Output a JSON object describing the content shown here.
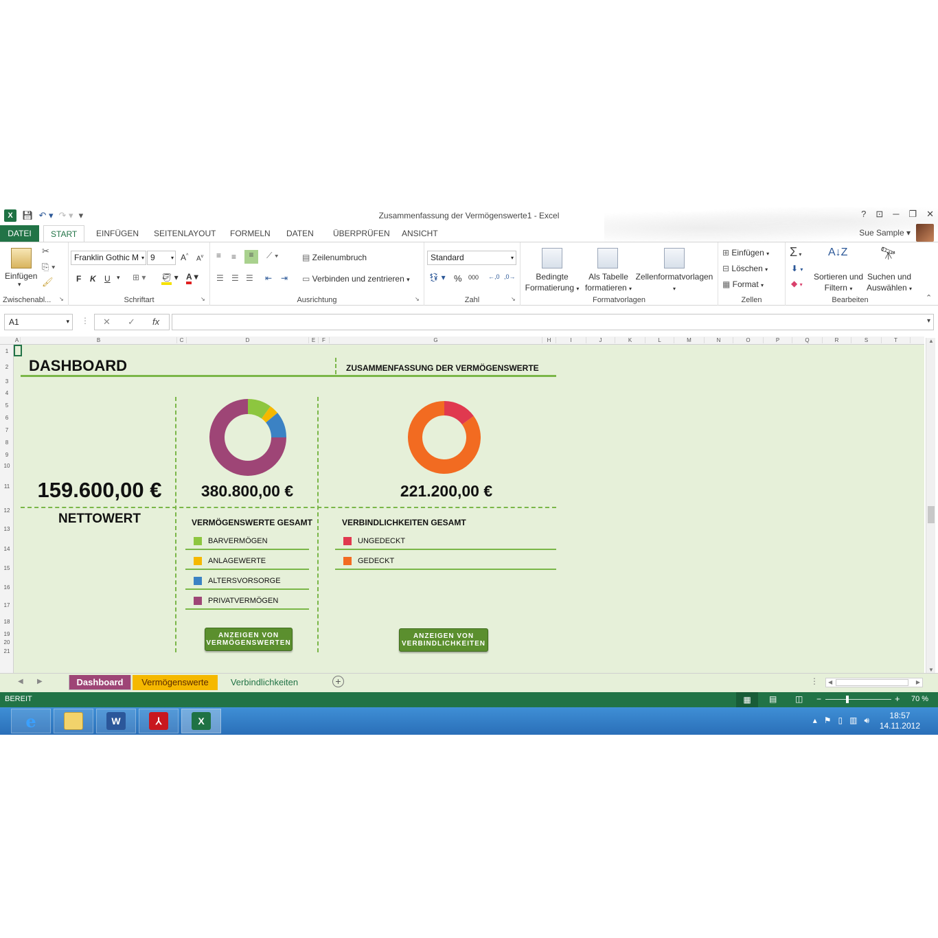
{
  "window": {
    "title": "Zusammenfassung der Vermögenswerte1 - Excel",
    "user": "Sue Sample",
    "help": "?",
    "controls": [
      "⊡",
      "─",
      "❐",
      "✕"
    ]
  },
  "ribbon_tabs": [
    "DATEI",
    "START",
    "EINFÜGEN",
    "SEITENLAYOUT",
    "FORMELN",
    "DATEN",
    "ÜBERPRÜFEN",
    "ANSICHT"
  ],
  "clipboard": {
    "paste_label": "Einfügen",
    "group_label": "Zwischenabl..."
  },
  "font": {
    "font_name": "Franklin Gothic M",
    "font_size": "9",
    "bold": "F",
    "italic": "K",
    "underline": "U",
    "group_label": "Schriftart"
  },
  "alignment": {
    "wrap_label": "Zeilenumbruch",
    "merge_label": "Verbinden und zentrieren",
    "group_label": "Ausrichtung"
  },
  "number": {
    "format": "Standard",
    "percent": "%",
    "thousands": "000",
    "group_label": "Zahl"
  },
  "styles": {
    "conditional": [
      "Bedingte",
      "Formatierung"
    ],
    "as_table": [
      "Als Tabelle",
      "formatieren"
    ],
    "cell_styles": "Zellenformatvorlagen",
    "group_label": "Formatvorlagen"
  },
  "cells": {
    "insert": "Einfügen",
    "delete": "Löschen",
    "format": "Format",
    "group_label": "Zellen"
  },
  "editing": {
    "sort": [
      "Sortieren und",
      "Filtern"
    ],
    "find": [
      "Suchen und",
      "Auswählen"
    ],
    "group_label": "Bearbeiten"
  },
  "formula_bar": {
    "name_box": "A1",
    "fx": "fx",
    "cancel": "✕",
    "confirm": "✓"
  },
  "columns": [
    "A",
    "B",
    "C",
    "D",
    "E",
    "F",
    "G",
    "H",
    "I",
    "J",
    "K",
    "L",
    "M",
    "N",
    "O",
    "P",
    "Q",
    "R",
    "S",
    "T"
  ],
  "rows": [
    "1",
    "2",
    "3",
    "4",
    "5",
    "6",
    "7",
    "8",
    "9",
    "10",
    "11",
    "12",
    "13",
    "14",
    "15",
    "16",
    "17",
    "18",
    "19",
    "20",
    "21"
  ],
  "dashboard": {
    "title": "DASHBOARD",
    "subtitle": "ZUSAMMENFASSUNG DER VERMÖGENSWERTE",
    "net_worth_value": "159.600,00 €",
    "net_worth_label": "NETTOWERT",
    "assets_total": "380.800,00 €",
    "assets_heading": "VERMÖGENSWERTE GESAMT",
    "assets_legend": [
      {
        "label": "BARVERMÖGEN",
        "color": "#8dc63f"
      },
      {
        "label": "ANLAGEWERTE",
        "color": "#f5b800"
      },
      {
        "label": "ALTERSVORSORGE",
        "color": "#3b82c4"
      },
      {
        "label": "PRIVATVERMÖGEN",
        "color": "#9e4576"
      }
    ],
    "assets_share": [
      0.1,
      0.04,
      0.11,
      0.75
    ],
    "liabilities_total": "221.200,00 €",
    "liabilities_heading": "VERBINDLICHKEITEN GESAMT",
    "liabilities_legend": [
      {
        "label": "UNGEDECKT",
        "color": "#e0394f"
      },
      {
        "label": "GEDECKT",
        "color": "#f26b21"
      }
    ],
    "liabilities_share": [
      0.15,
      0.85
    ],
    "assets_button": [
      "ANZEIGEN VON",
      "VERMÖGENSWERTEN"
    ],
    "liabilities_button": [
      "ANZEIGEN VON",
      "VERBINDLICHKEITEN"
    ]
  },
  "sheet_tabs": [
    {
      "label": "Dashboard",
      "color": "#e6f0d9",
      "text": "#217346"
    },
    {
      "label": "Vermögenswerte",
      "color": "#9e4576",
      "text": "#ffffff"
    },
    {
      "label": "Verbindlichkeiten",
      "color": "#f5b800",
      "text": "#5a2a00"
    }
  ],
  "status": {
    "ready": "BEREIT",
    "zoom": "70 %"
  },
  "taskbar": {
    "time": "18:57",
    "date": "14.11.2012"
  }
}
